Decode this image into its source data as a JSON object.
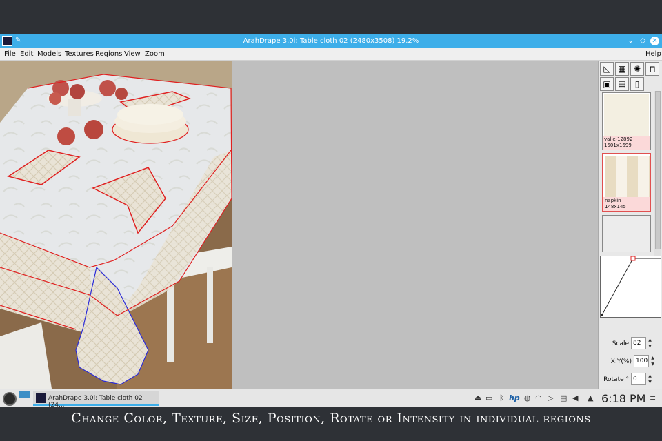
{
  "window": {
    "title": "ArahDrape 3.0i: Table cloth 02 (2480x3508) 19.2%",
    "pin_icon": "pin-icon",
    "buttons": [
      "chevron-down-icon",
      "diamond-icon",
      "close-icon"
    ]
  },
  "menu": {
    "items": [
      "File",
      "Edit",
      "Models",
      "Textures",
      "Regions",
      "View",
      "Zoom"
    ],
    "help": "Help"
  },
  "sidebar": {
    "tools": [
      "brush-icon",
      "palette-icon",
      "color-wheel-icon",
      "lock-icon",
      "texture-swap-icon",
      "grid-icon",
      "cylinder-icon"
    ],
    "swatches": [
      {
        "name": "valle-12892",
        "size": "1501x1699",
        "selected": false
      },
      {
        "name": "napkin",
        "size": "148x145",
        "selected": true
      },
      {
        "name": "",
        "size": "",
        "selected": false
      }
    ],
    "scale_label": "Scale",
    "scale_value": "82",
    "xy_label": "X:Y(%)",
    "xy_value": "100",
    "rotate_label": "Rotate °",
    "rotate_value": "0"
  },
  "taskbar": {
    "task_label": "ArahDrape 3.0i: Table cloth 02 (24...",
    "clock": "6:18 PM",
    "tray_icons": [
      "usb-icon",
      "battery-icon",
      "bluetooth-icon",
      "hp-icon",
      "updates-icon",
      "wifi-icon",
      "media-icon",
      "clipboard-icon",
      "volume-muted-icon",
      "arrow-up-icon"
    ],
    "hp_text": "hp"
  },
  "caption": "Change Color, Texture, Size, Position, Rotate or Intensity in individual regions",
  "colors": {
    "accent": "#3daee9",
    "region_outline": "#e02020",
    "selected_outline": "#2b2bd8"
  }
}
